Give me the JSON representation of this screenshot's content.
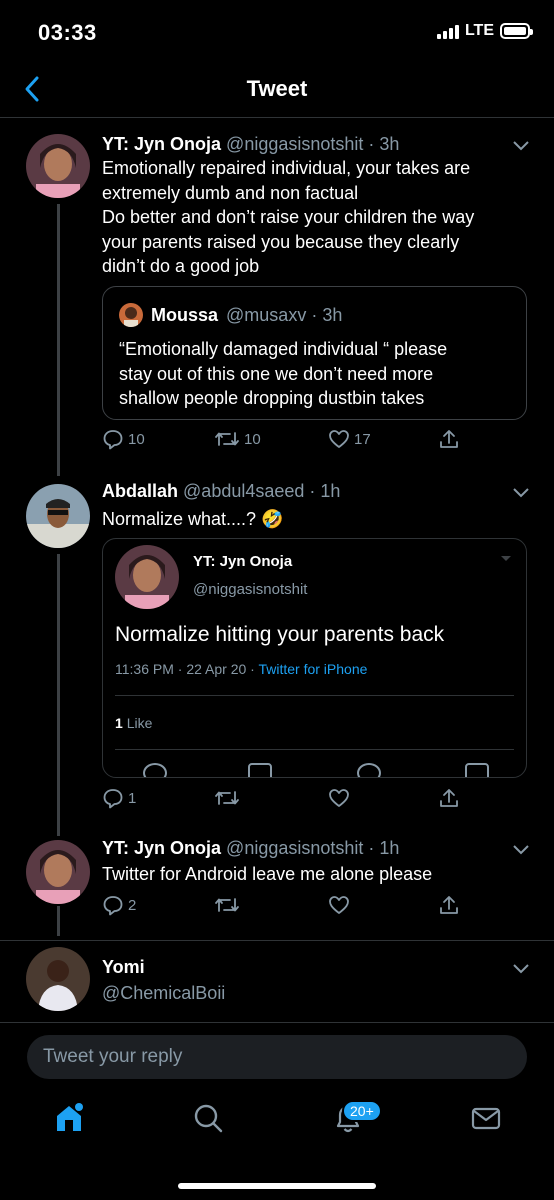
{
  "status_bar": {
    "time": "03:33",
    "network": "LTE"
  },
  "header": {
    "title": "Tweet"
  },
  "tweets": [
    {
      "name": "YT: Jyn Onoja",
      "handle": "@niggasisnotshit",
      "time": "3h",
      "text_lines": [
        "Emotionally repaired individual, your takes are",
        "extremely dumb and non factual",
        "Do better and don’t raise your children the way",
        "your parents raised you because they clearly",
        "didn’t do a good job"
      ],
      "quote": {
        "name": "Moussa",
        "handle": "@musaxv",
        "time": "3h",
        "text_lines": [
          "“Emotionally damaged individual “ please",
          "stay out of this one we don’t need more",
          "shallow people dropping dustbin takes"
        ]
      },
      "replies": "10",
      "retweets": "10",
      "likes": "17"
    },
    {
      "name": "Abdallah",
      "handle": "@abdul4saeed",
      "time": "1h",
      "text": "Normalize what....? 🤣",
      "embed": {
        "name": "YT: Jyn Onoja",
        "handle": "@niggasisnotshit",
        "text": "Normalize hitting your parents back",
        "timestamp": "11:36 PM · 22 Apr 20 · ",
        "via": "Twitter for iPhone",
        "likes_count": "1",
        "likes_label": "Like"
      },
      "replies": "1"
    },
    {
      "name": "YT: Jyn Onoja",
      "handle": "@niggasisnotshit",
      "time": "1h",
      "text": "Twitter for Android leave me alone please",
      "replies": "2"
    },
    {
      "name": "Yomi",
      "handle": "@ChemicalBoii"
    }
  ],
  "reply_bar": {
    "placeholder": "Tweet your reply"
  },
  "tabbar": {
    "notifications_badge": "20+"
  },
  "colors": {
    "accent": "#1da1f2",
    "muted": "#8899a6",
    "divider": "#2f3336"
  }
}
